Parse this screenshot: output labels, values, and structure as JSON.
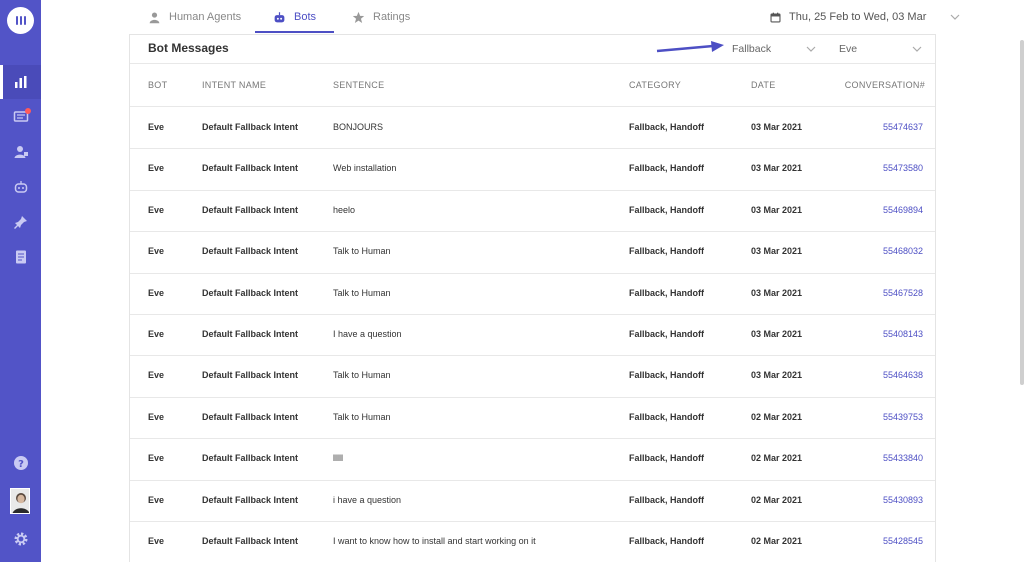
{
  "sidebar": {
    "items": [
      {
        "icon": "chart-icon",
        "active": true
      },
      {
        "icon": "messages-icon",
        "active": false,
        "badge": true
      },
      {
        "icon": "agents-icon",
        "active": false
      },
      {
        "icon": "bot-icon",
        "active": false
      },
      {
        "icon": "pin-icon",
        "active": false
      },
      {
        "icon": "document-icon",
        "active": false
      }
    ],
    "bottom": [
      {
        "icon": "help-icon"
      },
      {
        "icon": "avatar"
      },
      {
        "icon": "gear-icon"
      }
    ]
  },
  "tabs": [
    {
      "label": "Human Agents",
      "icon": "person-icon"
    },
    {
      "label": "Bots",
      "icon": "bot-icon"
    },
    {
      "label": "Ratings",
      "icon": "star-icon"
    }
  ],
  "date_range": "Thu, 25 Feb to Wed, 03 Mar",
  "card": {
    "title": "Bot Messages",
    "filter_category": "Fallback",
    "filter_bot": "Eve"
  },
  "table": {
    "headers": [
      "BOT",
      "INTENT NAME",
      "SENTENCE",
      "CATEGORY",
      "DATE",
      "CONVERSATION#"
    ],
    "rows": [
      {
        "bot": "Eve",
        "intent": "Default Fallback Intent",
        "sentence": "BONJOURS",
        "category": "Fallback, Handoff",
        "date": "03 Mar 2021",
        "conv": "55474637"
      },
      {
        "bot": "Eve",
        "intent": "Default Fallback Intent",
        "sentence": "Web installation",
        "category": "Fallback, Handoff",
        "date": "03 Mar 2021",
        "conv": "55473580"
      },
      {
        "bot": "Eve",
        "intent": "Default Fallback Intent",
        "sentence": "heelo",
        "category": "Fallback, Handoff",
        "date": "03 Mar 2021",
        "conv": "55469894"
      },
      {
        "bot": "Eve",
        "intent": "Default Fallback Intent",
        "sentence": "Talk to Human",
        "category": "Fallback, Handoff",
        "date": "03 Mar 2021",
        "conv": "55468032"
      },
      {
        "bot": "Eve",
        "intent": "Default Fallback Intent",
        "sentence": "Talk to Human",
        "category": "Fallback, Handoff",
        "date": "03 Mar 2021",
        "conv": "55467528"
      },
      {
        "bot": "Eve",
        "intent": "Default Fallback Intent",
        "sentence": "I have a question",
        "category": "Fallback, Handoff",
        "date": "03 Mar 2021",
        "conv": "55408143"
      },
      {
        "bot": "Eve",
        "intent": "Default Fallback Intent",
        "sentence": "Talk to Human",
        "category": "Fallback, Handoff",
        "date": "03 Mar 2021",
        "conv": "55464638"
      },
      {
        "bot": "Eve",
        "intent": "Default Fallback Intent",
        "sentence": "Talk to Human",
        "category": "Fallback, Handoff",
        "date": "02 Mar 2021",
        "conv": "55439753"
      },
      {
        "bot": "Eve",
        "intent": "Default Fallback Intent",
        "sentence": "lllll",
        "category": "Fallback, Handoff",
        "date": "02 Mar 2021",
        "conv": "55433840"
      },
      {
        "bot": "Eve",
        "intent": "Default Fallback Intent",
        "sentence": "i have a question",
        "category": "Fallback, Handoff",
        "date": "02 Mar 2021",
        "conv": "55430893"
      },
      {
        "bot": "Eve",
        "intent": "Default Fallback Intent",
        "sentence": "I want to know how to install and start working on it",
        "category": "Fallback, Handoff",
        "date": "02 Mar 2021",
        "conv": "55428545"
      }
    ]
  },
  "colors": {
    "sidebar": "#5254c7",
    "accent": "#4d4fc4",
    "badge": "#ff5a5a"
  }
}
